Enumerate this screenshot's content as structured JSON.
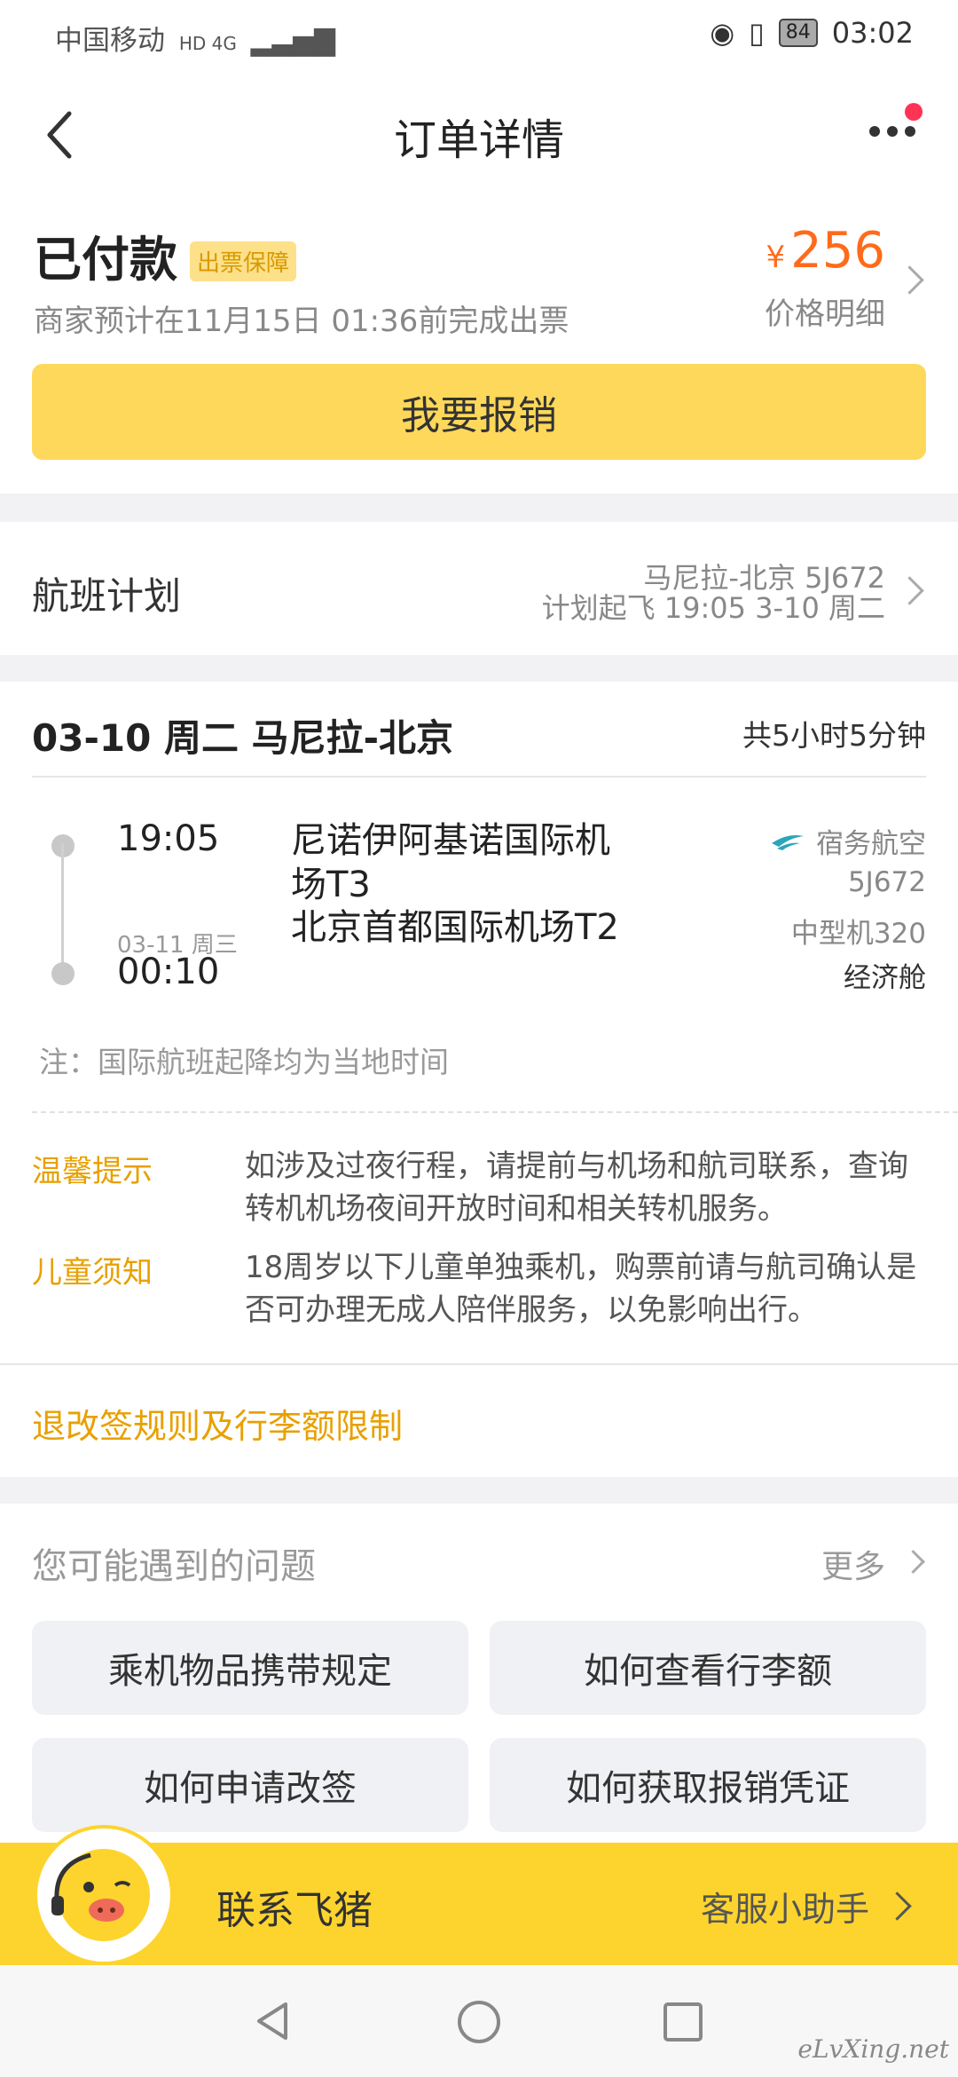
{
  "status_bar": {
    "carrier": "中国移动",
    "network": "HD 4G",
    "battery": "84",
    "time": "03:02"
  },
  "header": {
    "title": "订单详情"
  },
  "payment": {
    "status": "已付款",
    "badge": "出票保障",
    "eta": "商家预计在11月15日 01:36前完成出票",
    "currency": "¥",
    "price": "256",
    "price_detail": "价格明细",
    "reimburse_button": "我要报销"
  },
  "flight_plan": {
    "label": "航班计划",
    "route": "马尼拉-北京 5J672",
    "schedule": "计划起飞 19:05 3-10 周二"
  },
  "flight": {
    "title": "03-10 周二 马尼拉-北京",
    "duration": "共5小时5分钟",
    "depart_time": "19:05",
    "depart_airport": "尼诺伊阿基诺国际机场T3",
    "arrive_date": "03-11 周三",
    "arrive_time": "00:10",
    "arrive_airport": "北京首都国际机场T2",
    "airline": "宿务航空",
    "flight_no": "5J672",
    "aircraft": "中型机320",
    "cabin": "经济舱",
    "note": "注：国际航班起降均为当地时间"
  },
  "tips": [
    {
      "label": "温馨提示",
      "text": "如涉及过夜行程，请提前与机场和航司联系，查询转机机场夜间开放时间和相关转机服务。"
    },
    {
      "label": "儿童须知",
      "text": "18周岁以下儿童单独乘机，购票前请与航司确认是否可办理无成人陪伴服务，以免影响出行。"
    }
  ],
  "rules_link": "退改签规则及行李额限制",
  "faq": {
    "heading": "您可能遇到的问题",
    "more": "更多",
    "items": [
      "乘机物品携带规定",
      "如何查看行李额",
      "如何申请改签",
      "如何获取报销凭证"
    ]
  },
  "contact": {
    "label": "联系飞猪",
    "assistant": "客服小助手"
  },
  "watermark": "eLvXing.net",
  "colors": {
    "accent_yellow": "#fdd42e",
    "price_orange": "#ff6b1a",
    "tip_gold": "#e8a000",
    "notif_dot": "#ff3355"
  }
}
